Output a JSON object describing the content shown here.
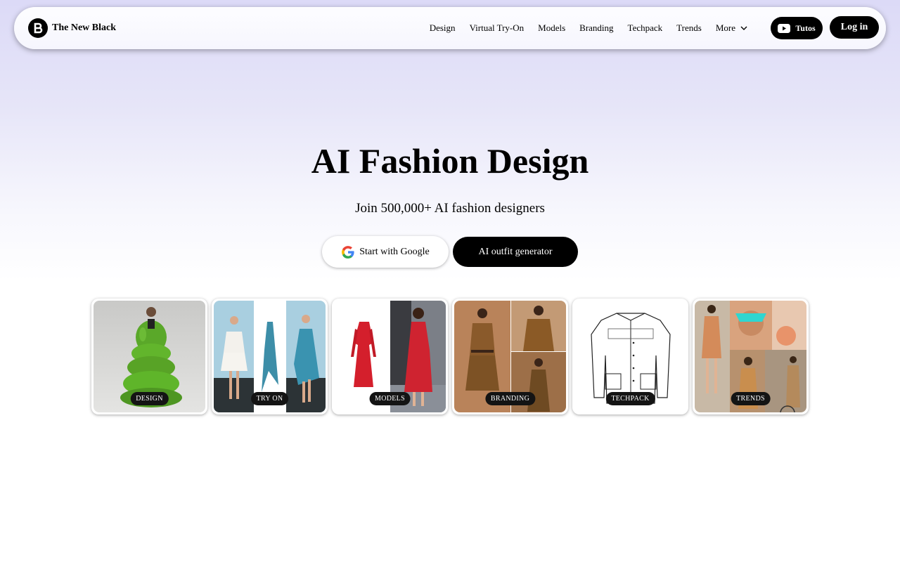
{
  "header": {
    "brand": "The New Black",
    "nav": [
      "Design",
      "Virtual Try-On",
      "Models",
      "Branding",
      "Techpack",
      "Trends"
    ],
    "more_label": "More",
    "tutos_label": "Tutos",
    "login_label": "Log in"
  },
  "hero": {
    "title": "AI Fashion Design",
    "subtitle": "Join 500,000+ AI fashion designers",
    "google_button": "Start with Google",
    "outfit_button": "AI outfit generator"
  },
  "cards": [
    {
      "label": "DESIGN"
    },
    {
      "label": "TRY ON"
    },
    {
      "label": "MODELS"
    },
    {
      "label": "BRANDING"
    },
    {
      "label": "TECHPACK"
    },
    {
      "label": "TRENDS"
    }
  ],
  "colors": {
    "accent": "#000000",
    "puffer_green": "#5fb52a",
    "dress_red": "#d41f2c",
    "brown": "#8a5a2b"
  }
}
